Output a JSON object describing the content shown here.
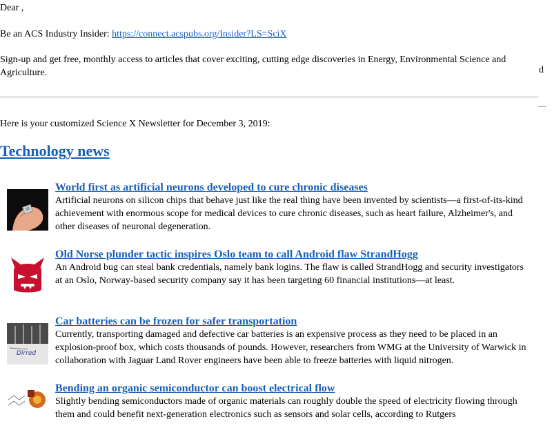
{
  "greeting": "Dear ,",
  "insider": {
    "prefix": "Be an ACS Industry Insider: ",
    "link": "https://connect.acspubs.org/Insider?LS=SciX"
  },
  "signup_text": "Sign-up and get free, monthly access to articles that cover exciting, cutting edge discoveries in Energy, Environmental Science and Agriculture.",
  "edge_char": "d",
  "intro": "Here is your customized Science X Newsletter for December 3, 2019:",
  "section_title": "Technology news",
  "articles": [
    {
      "title": "World first as artificial neurons developed to cure chronic diseases",
      "body": "Artificial neurons on silicon chips that behave just like the real thing have been invented by scientists—a first-of-its-kind achievement with enormous scope for medical devices to cure chronic diseases, such as heart failure, Alzheimer's, and other diseases of neuronal degeneration.",
      "thumb_icon": "chip-on-fingertip-image"
    },
    {
      "title": "Old Norse plunder tactic inspires Oslo team to call Android flaw StrandHogg",
      "body": "An Android bug can steal bank credentials, namely bank logins. The flaw is called StrandHogg and security investigators at an Oslo, Norway-based security company say it has been targeting 60 financial institutions—at least.",
      "thumb_icon": "red-devil-image"
    },
    {
      "title": "Car batteries can be frozen for safer transportation",
      "body": "Currently, transporting damaged and defective car batteries is an expensive process as they need to be placed in an explosion-proof box, which costs thousands of pounds. However, researchers from WMG at the University of Warwick in collaboration with Jaguar Land Rover engineers have been able to freeze batteries with liquid nitrogen.",
      "thumb_icon": "frozen-battery-image",
      "thumb_text": "Dirred"
    },
    {
      "title": "Bending an organic semiconductor can boost electrical flow",
      "body": "Slightly bending semiconductors made of organic materials can roughly double the speed of electricity flowing through them and could benefit next-generation electronics such as sensors and solar cells, according to Rutgers",
      "thumb_icon": "organic-semiconductor-image"
    }
  ]
}
